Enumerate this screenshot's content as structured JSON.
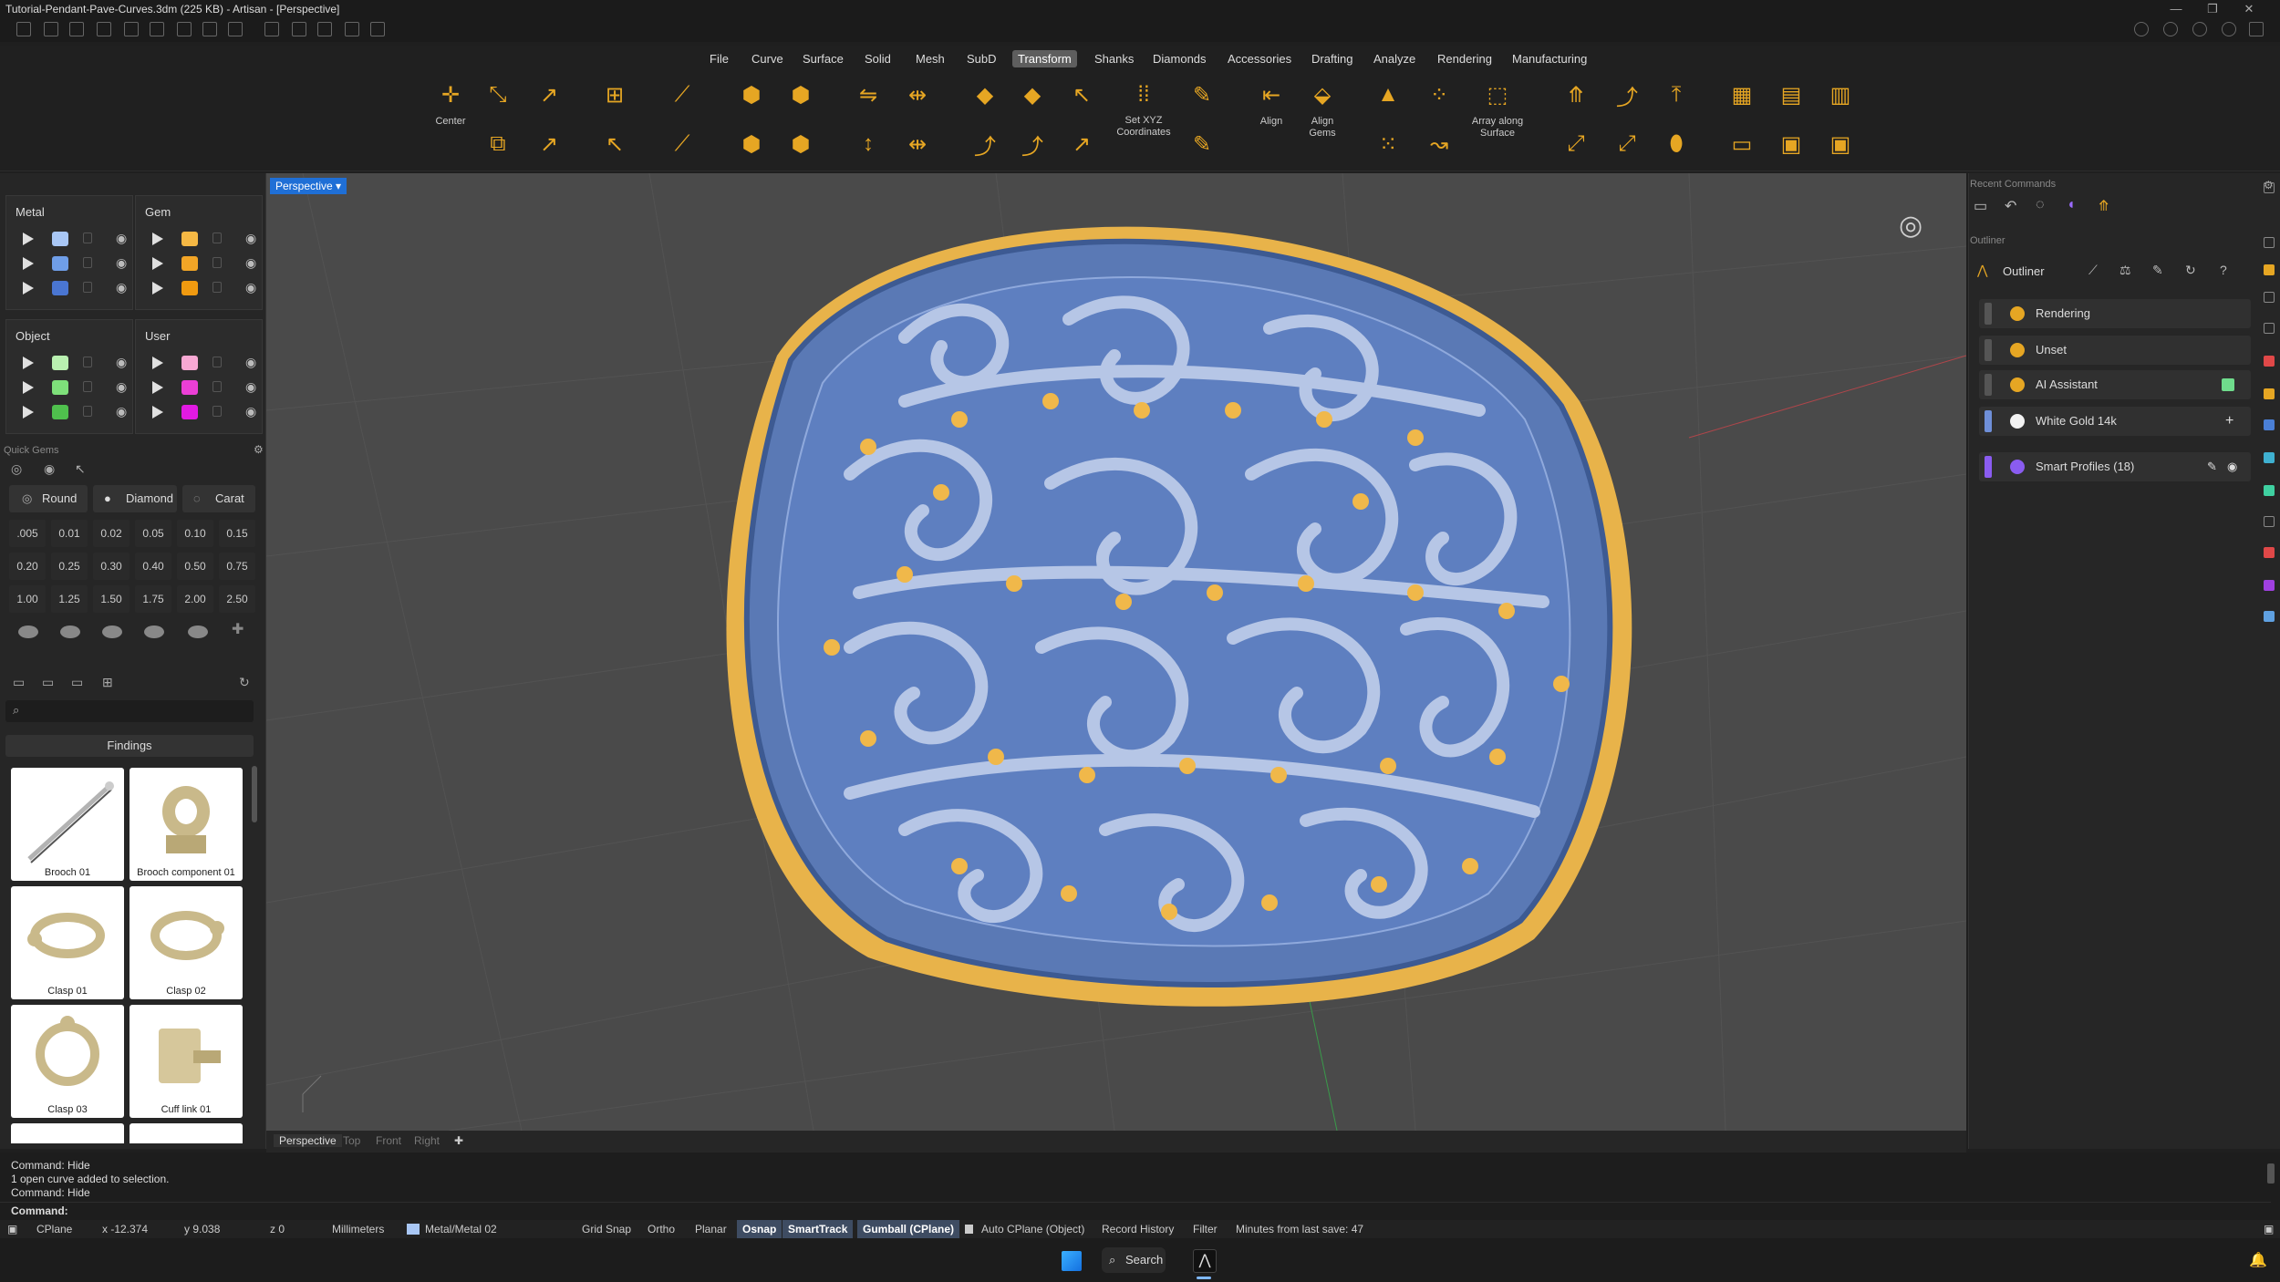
{
  "window": {
    "title": "Tutorial-Pendant-Pave-Curves.3dm (225 KB) - Artisan - [Perspective]"
  },
  "menu": [
    "File",
    "Curve",
    "Surface",
    "Solid",
    "Mesh",
    "SubD",
    "Transform",
    "Shanks",
    "Diamonds",
    "Accessories",
    "Drafting",
    "Analyze",
    "Rendering",
    "Manufacturing"
  ],
  "ribbon": {
    "center": "Center",
    "set_xyz": "Set XYZ\nCoordinates",
    "align": "Align",
    "align_gems": "Align\nGems",
    "array_along": "Array along\nSurface"
  },
  "layers": {
    "metal": {
      "title": "Metal",
      "colors": [
        "#a9c7f5",
        "#6f9ee8",
        "#4a76d2"
      ]
    },
    "gem": {
      "title": "Gem",
      "colors": [
        "#f5b844",
        "#f2a526",
        "#f09a10"
      ]
    },
    "object": {
      "title": "Object",
      "colors": [
        "#b9f0b0",
        "#7ee07a",
        "#4fc04d"
      ]
    },
    "user": {
      "title": "User",
      "colors": [
        "#f7a8d3",
        "#ec3fd6",
        "#e21ae3"
      ]
    }
  },
  "quick_gems": {
    "title": "Quick Gems",
    "shape": "Round",
    "cut": "Diamond",
    "unit": "Carat",
    "sizes": [
      ".005",
      "0.01",
      "0.02",
      "0.05",
      "0.10",
      "0.15",
      "0.20",
      "0.25",
      "0.30",
      "0.40",
      "0.50",
      "0.75",
      "1.00",
      "1.25",
      "1.50",
      "1.75",
      "2.00",
      "2.50"
    ]
  },
  "library": {
    "search_placeholder": "",
    "category": "Findings",
    "items": [
      "Brooch 01",
      "Brooch component 01",
      "Clasp 01",
      "Clasp 02",
      "Clasp 03",
      "Cuff link 01"
    ]
  },
  "viewport": {
    "active": "Perspective",
    "tabs": [
      "Perspective",
      "Top",
      "Front",
      "Right"
    ]
  },
  "right_panel": {
    "recent": "Recent Commands",
    "outliner_section": "Outliner",
    "outliner_title": "Outliner",
    "rows": [
      {
        "label": "Rendering",
        "color": "#e6a623"
      },
      {
        "label": "Unset",
        "color": "#e6a623"
      },
      {
        "label": "AI Assistant",
        "color": "#e6a623"
      },
      {
        "label": "White Gold 14k",
        "color": "#f2f2f2"
      },
      {
        "label": "Smart Profiles (18)",
        "color": "#8a5cf0"
      }
    ]
  },
  "command_history": [
    "Command: Hide",
    "1 open curve added to selection.",
    "Command: Hide"
  ],
  "command_prompt": "Command:",
  "status": {
    "cplane": "CPlane",
    "x": "x -12.374",
    "y": "y 9.038",
    "z": "z 0",
    "units": "Millimeters",
    "layer": "Metal/Metal 02",
    "grid_snap": "Grid Snap",
    "ortho": "Ortho",
    "planar": "Planar",
    "osnap": "Osnap",
    "smarttrack": "SmartTrack",
    "gumball": "Gumball (CPlane)",
    "auto_cplane": "Auto CPlane (Object)",
    "record_history": "Record History",
    "filter": "Filter",
    "minutes": "Minutes from last save: 47"
  },
  "taskbar": {
    "search": "Search"
  }
}
